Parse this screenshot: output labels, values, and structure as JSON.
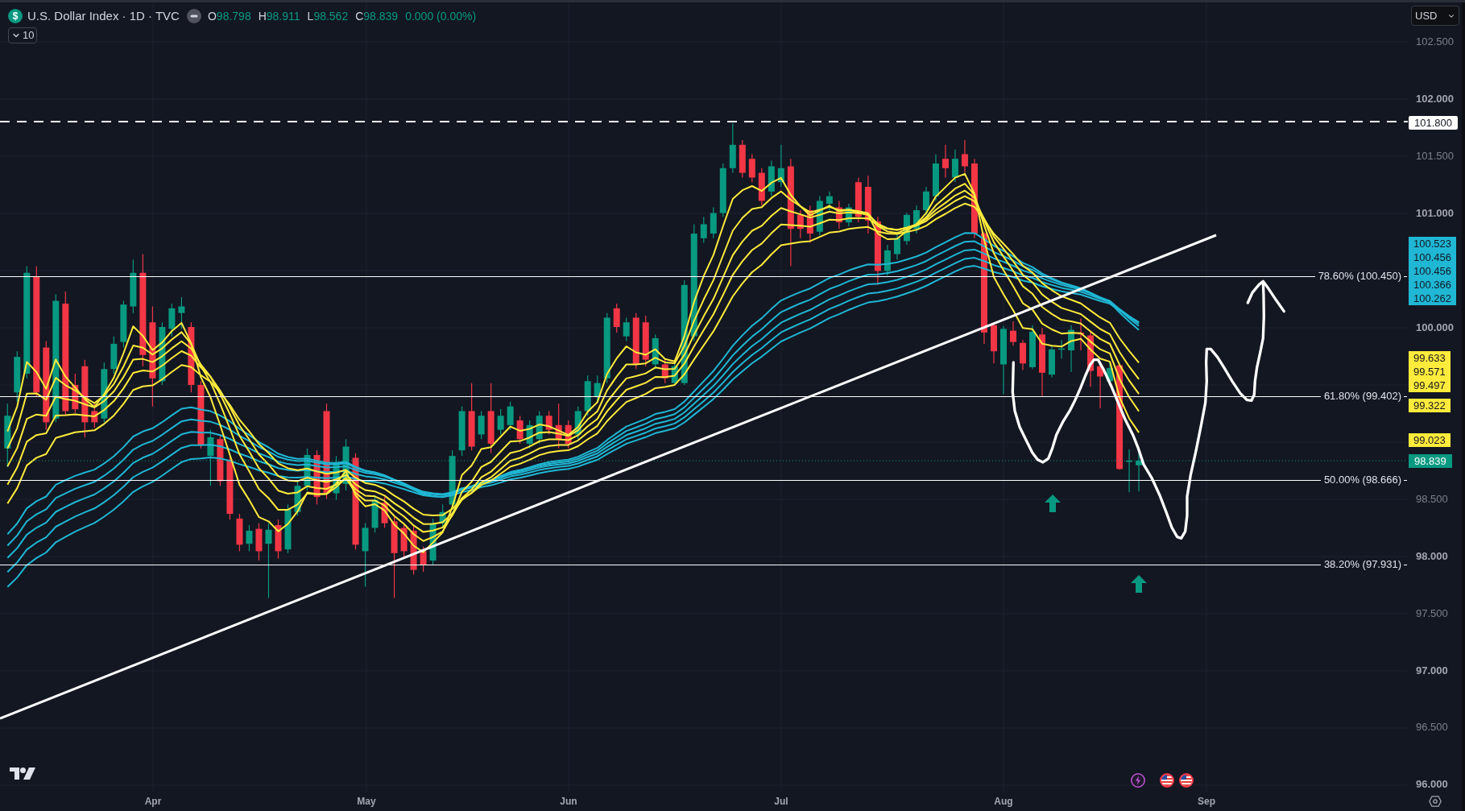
{
  "symbol": {
    "logo": "$",
    "title": "U.S. Dollar Index · 1D · TVC",
    "rising": true,
    "ohlc": [
      {
        "label": "O",
        "value": "98.798"
      },
      {
        "label": "H",
        "value": "98.911"
      },
      {
        "label": "L",
        "value": "98.562"
      },
      {
        "label": "C",
        "value": "98.839"
      }
    ],
    "change": "0.000 (0.00%)"
  },
  "indicators": {
    "count": "10",
    "expanded": false
  },
  "currency": "USD",
  "price_axis": [
    {
      "label": "102.500",
      "major": false
    },
    {
      "label": "102.000",
      "major": true
    },
    {
      "label": "101.500",
      "major": false
    },
    {
      "label": "101.000",
      "major": true
    },
    {
      "label": "100.000",
      "major": true
    },
    {
      "label": "98.500",
      "major": false
    },
    {
      "label": "98.000",
      "major": true
    },
    {
      "label": "97.500",
      "major": false
    },
    {
      "label": "97.000",
      "major": true
    },
    {
      "label": "96.500",
      "major": false
    },
    {
      "label": "96.000",
      "major": true
    }
  ],
  "level_tag": "101.800",
  "indicator_tags": [
    {
      "value": "100.523",
      "color": "#1fb7d4"
    },
    {
      "value": "100.456",
      "color": "#1fb7d4"
    },
    {
      "value": "100.456",
      "color": "#1fb7d4"
    },
    {
      "value": "100.366",
      "color": "#1fb7d4"
    },
    {
      "value": "100.262",
      "color": "#1fb7d4"
    },
    {
      "value": "99.633",
      "color": "#ffeb3b"
    },
    {
      "value": "99.571",
      "color": "#ffeb3b"
    },
    {
      "value": "99.497",
      "color": "#ffeb3b"
    },
    {
      "value": "99.322",
      "color": "#ffeb3b"
    },
    {
      "value": "99.023",
      "color": "#ffeb3b"
    }
  ],
  "last_price": "98.839",
  "fib_levels": [
    "78.60% (100.450)",
    "61.80% (99.402)",
    "50.00% (98.666)",
    "38.20% (97.931)"
  ],
  "time_axis": [
    "Apr",
    "May",
    "Jun",
    "Jul",
    "Aug",
    "Sep"
  ]
}
